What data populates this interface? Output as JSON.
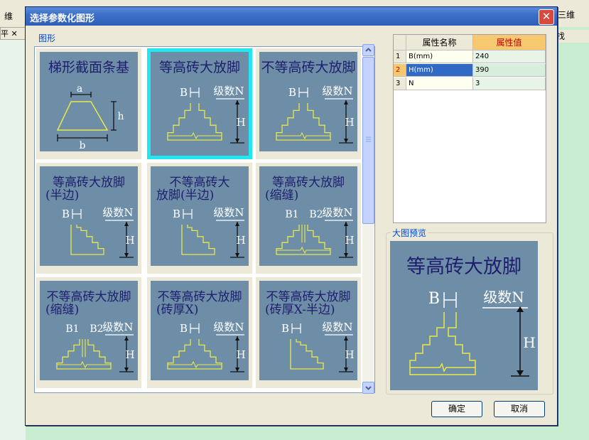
{
  "background": {
    "toolbar_items": [
      "维",
      "三维",
      "找"
    ],
    "left_tab": "平 ✕"
  },
  "dialog": {
    "title": "选择参数化图形",
    "close_symbol": "✕",
    "group_figures": "图形",
    "group_preview": "大图预览",
    "ok_label": "确定",
    "cancel_label": "取消"
  },
  "properties": {
    "col_name": "属性名称",
    "col_value": "属性值",
    "rows": [
      {
        "no": "1",
        "name": "B(mm)",
        "value": "240"
      },
      {
        "no": "2",
        "name": "H(mm)",
        "value": "390"
      },
      {
        "no": "3",
        "name": "N",
        "value": "3"
      }
    ]
  },
  "tiles": [
    {
      "title_l1": "梯形截面条基",
      "title_l2": "",
      "kind": "trapezoid"
    },
    {
      "title_l1": "等高砖大放脚",
      "title_l2": "",
      "kind": "full"
    },
    {
      "title_l1": "不等高砖大放脚",
      "title_l2": "",
      "kind": "full"
    },
    {
      "title_l1": "等高砖大放脚",
      "title_l2": "(半边)",
      "kind": "half"
    },
    {
      "title_l1": "不等高砖大",
      "title_l2": "放脚(半边)",
      "kind": "half"
    },
    {
      "title_l1": "等高砖大放脚",
      "title_l2": "(缩缝)",
      "kind": "gap"
    },
    {
      "title_l1": "不等高砖大放脚",
      "title_l2": "(缩缝)",
      "kind": "gap"
    },
    {
      "title_l1": "不等高砖大放脚",
      "title_l2": "(砖厚X)",
      "kind": "full"
    },
    {
      "title_l1": "不等高砖大放脚",
      "title_l2": "(砖厚X-半边)",
      "kind": "half"
    }
  ],
  "labels": {
    "a": "a",
    "b": "b",
    "h": "h",
    "B": "B",
    "H": "H",
    "level": "级数N",
    "B1": "B1",
    "B2": "B2"
  },
  "preview": {
    "title": "等高砖大放脚"
  },
  "colors": {
    "title_bar": "#3e6fc8",
    "selection": "#22e6f0",
    "figure_bg": "#6e8ea8",
    "figure_line": "#e8e84a",
    "figure_text": "#1e1e6e",
    "value_header": "#f8c870",
    "selected_row": "#316ac5"
  },
  "icons": {
    "close": "close-icon",
    "scroll_up": "scroll-up-icon",
    "scroll_down": "scroll-down-icon"
  }
}
